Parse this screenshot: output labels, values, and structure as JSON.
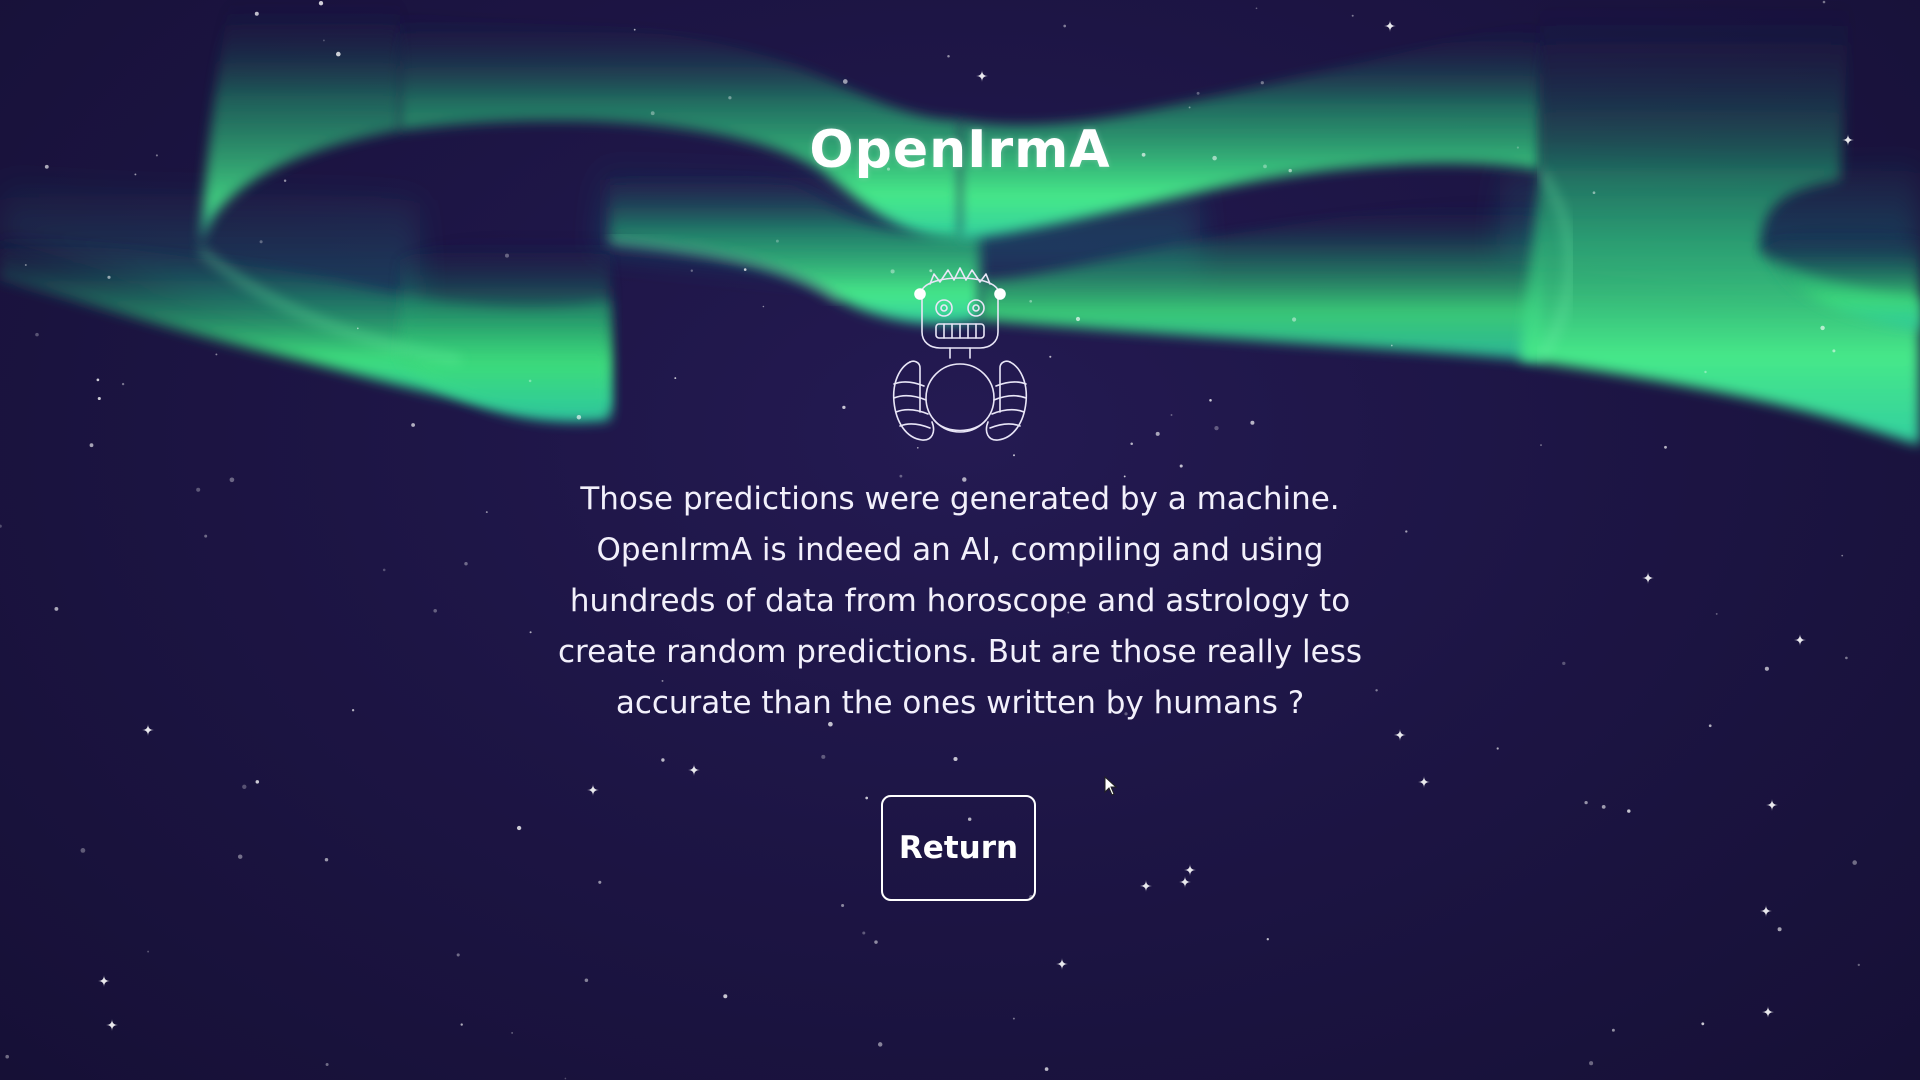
{
  "app": {
    "logo": "OpenIrmA"
  },
  "main": {
    "message_lines": [
      "Those predictions were generated by a machine.",
      "OpenIrmA is indeed an AI, compiling and using",
      "hundreds of data from horoscope and astrology to",
      "create random predictions. But are those really less",
      "accurate than the ones written by humans ?"
    ],
    "return_label": "Return"
  },
  "theme": {
    "background": "#1d1545",
    "aurora_green": "#3fe27a",
    "aurora_teal": "#2bc7a4",
    "text": "#ffffff"
  },
  "icons": {
    "mascot": "robot-fortune-teller-icon",
    "cursor": "mouse-pointer-icon",
    "stars": "star-icon"
  }
}
